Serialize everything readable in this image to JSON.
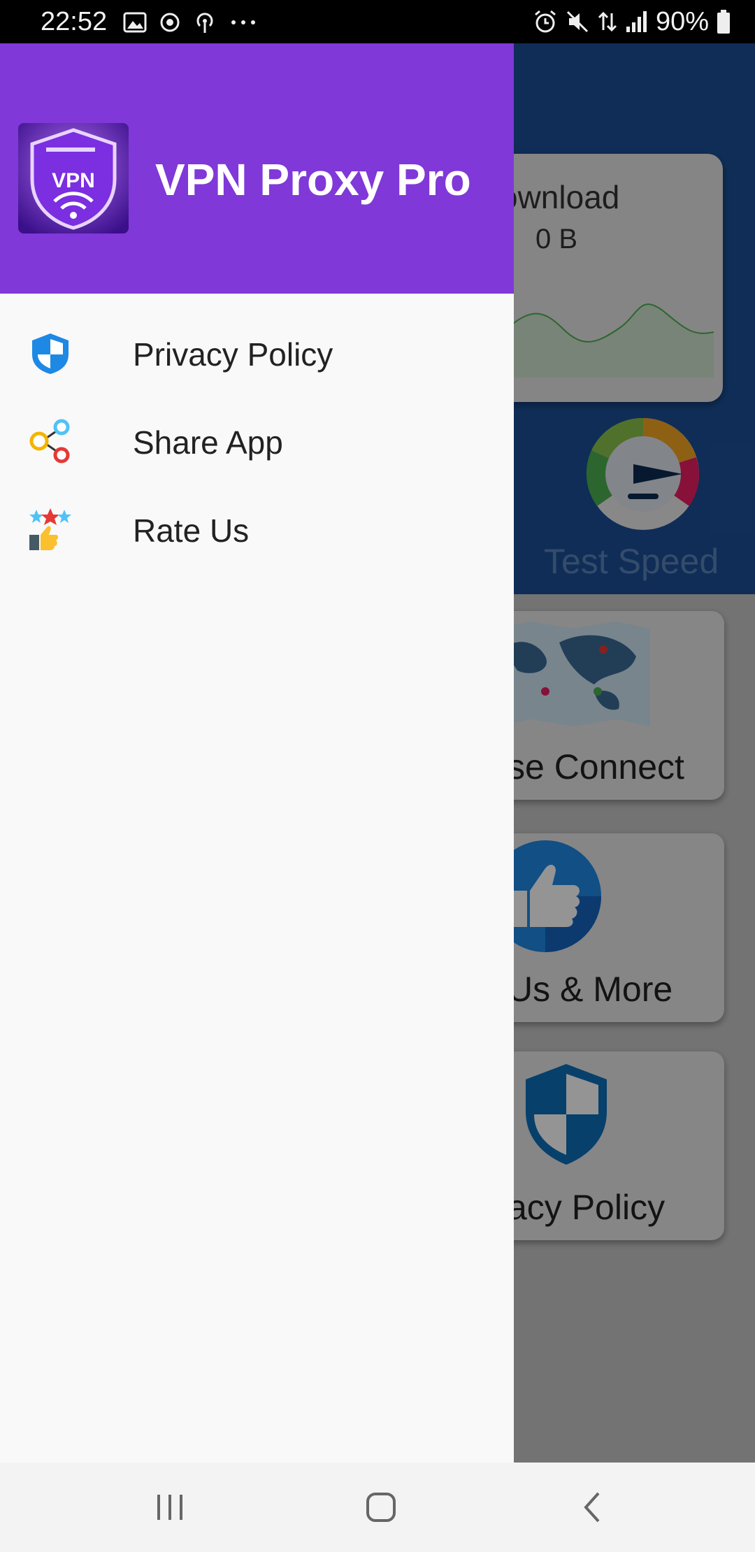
{
  "status_bar": {
    "time": "22:52",
    "battery": "90%",
    "icons": [
      "gallery-icon",
      "sync-icon",
      "hotspot-icon",
      "more-dots-icon",
      "alarm-icon",
      "mute-icon",
      "data-arrows-icon",
      "signal-icon",
      "battery-icon"
    ]
  },
  "drawer": {
    "app_name": "VPN Proxy Pro",
    "logo_text": "VPN",
    "header_color": "#8038d8",
    "menu": [
      {
        "label": "Privacy Policy",
        "icon": "shield-icon"
      },
      {
        "label": "Share App",
        "icon": "share-icon"
      },
      {
        "label": "Rate Us",
        "icon": "rate-stars-icon"
      }
    ]
  },
  "background_app": {
    "download_label": "ownload",
    "download_value": "0 B",
    "test_speed_label": "Test Speed",
    "cards": [
      {
        "label": "se Connect",
        "icon": "world-map-icon"
      },
      {
        "label": "Us & More",
        "icon": "thumbs-up-icon"
      },
      {
        "label": "acy Policy",
        "icon": "shield-icon"
      }
    ]
  },
  "nav_bar": {
    "buttons": [
      "recent-apps-icon",
      "home-icon",
      "back-icon"
    ]
  }
}
